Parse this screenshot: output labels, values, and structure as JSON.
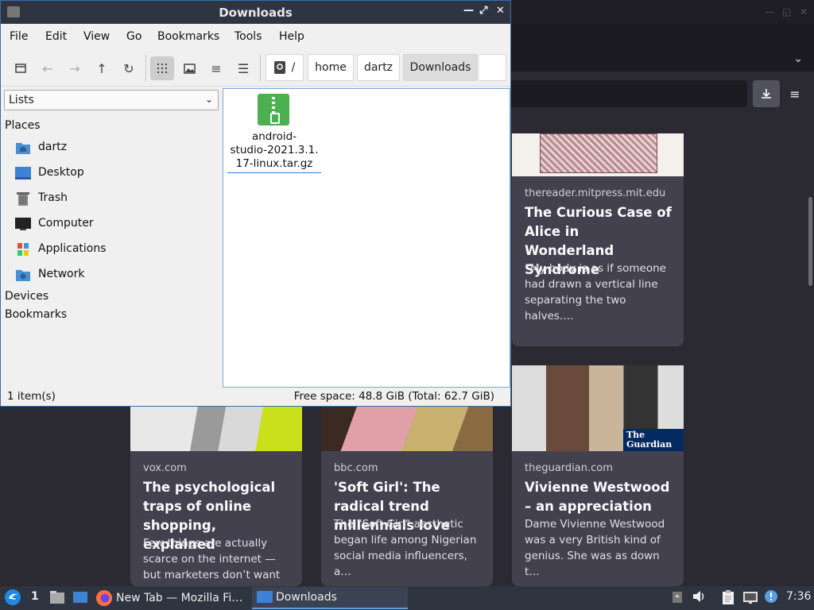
{
  "firefox": {
    "cards": [
      {
        "source": "thereader.mitpress.mit.edu",
        "title": "The Curious Case of Alice in Wonderland Syndrome",
        "excerpt": "“My body is as if someone had drawn a vertical line separating the two halves.…"
      },
      {
        "source": "vox.com",
        "title": "The psychological traps of online shopping, explained",
        "excerpt": "Few things are actually scarce on the internet — but marketers don’t want you …"
      },
      {
        "source": "bbc.com",
        "title": "'Soft Girl': The radical trend millennials love",
        "excerpt": "The \"Soft Girl\" aesthetic began life among Nigerian social media influencers, a…"
      },
      {
        "source": "theguardian.com",
        "title": "Vivienne Westwood – an appreciation",
        "excerpt": "Dame Vivienne Westwood was a very British kind of genius. She was as down t…"
      }
    ],
    "guardian_logo": "The Guardian"
  },
  "file_manager": {
    "title": "Downloads",
    "menu": [
      "File",
      "Edit",
      "View",
      "Go",
      "Bookmarks",
      "Tools",
      "Help"
    ],
    "breadcrumbs": [
      "/",
      "home",
      "dartz",
      "Downloads"
    ],
    "side_select": "Lists",
    "places_header": "Places",
    "places": [
      {
        "label": "dartz",
        "icon": "home-folder-icon"
      },
      {
        "label": "Desktop",
        "icon": "desktop-icon"
      },
      {
        "label": "Trash",
        "icon": "trash-icon"
      },
      {
        "label": "Computer",
        "icon": "computer-icon"
      },
      {
        "label": "Applications",
        "icon": "applications-icon"
      },
      {
        "label": "Network",
        "icon": "network-icon"
      }
    ],
    "devices_header": "Devices",
    "bookmarks_header": "Bookmarks",
    "file": {
      "name": "android-studio-2021.3.1.17-linux.tar.gz",
      "name_lines": [
        "android-",
        "studio-2021.3.1.",
        "17-linux.tar.gz"
      ]
    },
    "status_left": "1 item(s)",
    "status_right": "Free space: 48.8 GiB (Total: 62.7 GiB)"
  },
  "taskbar": {
    "workspace": "1",
    "tasks": [
      "New Tab — Mozilla Fi…",
      "Downloads"
    ],
    "clock": "7:36"
  },
  "colors": {
    "accent": "#3a7bd5",
    "archive_green": "#4caf50",
    "taskbar": "#2e3440",
    "firefox_bg": "#2b2a33"
  }
}
